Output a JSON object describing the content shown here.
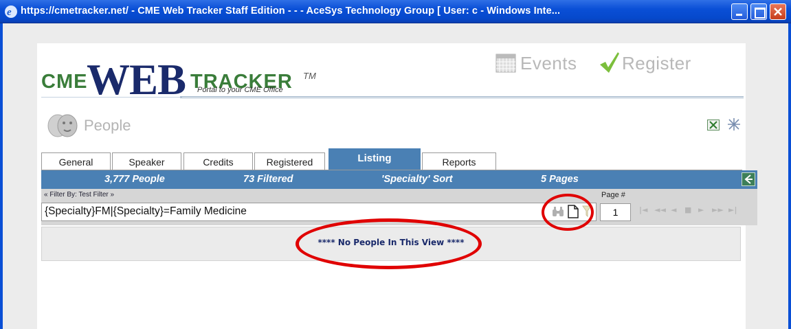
{
  "window": {
    "title": "https://cmetracker.net/ - CME Web Tracker Staff Edition - - - AceSys Technology Group [ User: c - Windows Inte..."
  },
  "logo": {
    "cme": "CME",
    "web": "WEB",
    "tracker": "TRACKER",
    "tm": "TM",
    "tagline": "Portal to your CME Office"
  },
  "header_links": {
    "events": "Events",
    "register": "Register"
  },
  "section": {
    "title": "People"
  },
  "tabs": [
    {
      "label": "General"
    },
    {
      "label": "Speaker"
    },
    {
      "label": "Credits"
    },
    {
      "label": "Registered"
    },
    {
      "label": "Listing",
      "active": true
    },
    {
      "label": "Reports"
    }
  ],
  "status": {
    "people": "3,777 People",
    "filtered": "73 Filtered",
    "sort": "'Specialty' Sort",
    "pages": "5 Pages"
  },
  "filter": {
    "label": "« Filter By: Test Filter »",
    "value": "{Specialty}FM|{Specialty}=Family Medicine"
  },
  "pagination": {
    "label": "Page #",
    "current": "1",
    "controls": [
      "|◄",
      "◄◄",
      "◄",
      "■",
      "►",
      "►►",
      "►|"
    ]
  },
  "results": {
    "empty_message": "**** No People In This View ****"
  },
  "colors": {
    "titlebar": "#0a4fd6",
    "status_bar": "#4a80b4",
    "logo_green": "#3a7d3a",
    "logo_navy": "#1a2a6b",
    "annotation_red": "#e00000"
  }
}
